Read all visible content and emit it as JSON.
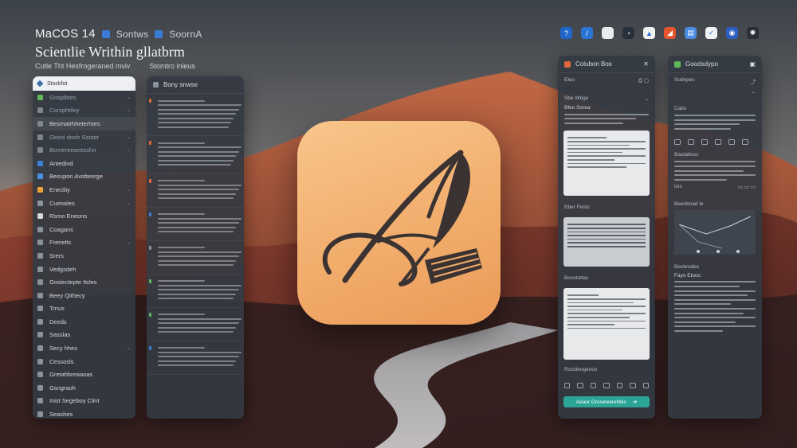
{
  "menubar": {
    "os_label": "MaCOS 14",
    "item_1": "Sontws",
    "item_2": "SoornA"
  },
  "app": {
    "title": "Scientlie Writhin gllatbrm",
    "subtitle_left": "Cutle Tht Hesfrogeraned mviv",
    "subtitle_right": "Stomtro inieus"
  },
  "dock_icons": [
    {
      "name": "safari-icon",
      "color": "#1e66c9",
      "glyph": "?"
    },
    {
      "name": "dictionary-icon",
      "color": "#2a74d6",
      "glyph": "/"
    },
    {
      "name": "notes-icon",
      "color": "#e9ecef",
      "glyph": ""
    },
    {
      "name": "clock-icon",
      "color": "#26303b",
      "glyph": "◔"
    },
    {
      "name": "drive-icon",
      "color": "#f2f2f2",
      "glyph": "▲"
    },
    {
      "name": "office-icon",
      "color": "#e4552d",
      "glyph": "◢"
    },
    {
      "name": "doc-icon",
      "color": "#4a8be0",
      "glyph": "▤"
    },
    {
      "name": "mail-icon",
      "color": "#f0f2f4",
      "glyph": "✓"
    },
    {
      "name": "globe-icon",
      "color": "#2d5fc2",
      "glyph": "◉"
    },
    {
      "name": "settings-icon",
      "color": "#2a2f36",
      "glyph": "✺"
    }
  ],
  "sidebar": {
    "search_label": "Stockfot",
    "items": [
      {
        "label": "Gosplbtes",
        "icon_color": "#5fb85a",
        "chev": "⌄",
        "style": "dim"
      },
      {
        "label": "Corsphtiley",
        "icon_color": "#7e8690",
        "chev": "⌄",
        "style": "dim"
      },
      {
        "label": "Besmatrhheterhtes",
        "icon_color": "#7e8690",
        "chev": "",
        "style": "hl"
      },
      {
        "label": "Gesni dooh Ssotor",
        "icon_color": "#7e8690",
        "chev": "⌄",
        "style": "dim"
      },
      {
        "label": "Bomereeseesshn",
        "icon_color": "#7e8690",
        "chev": "⌄",
        "style": "dim"
      },
      {
        "label": "Antedind",
        "icon_color": "#3e7fd6",
        "chev": "",
        "style": ""
      },
      {
        "label": "Besupon Avstteorge",
        "icon_color": "#4a90e2",
        "chev": "",
        "style": ""
      },
      {
        "label": "Enecliiy",
        "icon_color": "#e8a33b",
        "chev": "⌄",
        "style": ""
      },
      {
        "label": "Cueoales",
        "icon_color": "#8a929c",
        "chev": "⌄",
        "style": ""
      },
      {
        "label": "Rsmo Eneons",
        "icon_color": "#d5d8dc",
        "chev": "",
        "style": ""
      },
      {
        "label": "Coagans",
        "icon_color": "#8a929c",
        "chev": "",
        "style": ""
      },
      {
        "label": "Frenelts",
        "icon_color": "#8a929c",
        "chev": "⌄",
        "style": ""
      },
      {
        "label": "Srers",
        "icon_color": "#8a929c",
        "chev": "",
        "style": ""
      },
      {
        "label": "Vedgsdeh",
        "icon_color": "#8a929c",
        "chev": "",
        "style": ""
      },
      {
        "label": "Goslectepte Itcles",
        "icon_color": "#8a929c",
        "chev": "",
        "style": ""
      },
      {
        "label": "Beey Qithecy",
        "icon_color": "#8a929c",
        "chev": "",
        "style": ""
      },
      {
        "label": "Trnus",
        "icon_color": "#8a929c",
        "chev": "",
        "style": ""
      },
      {
        "label": "Deeds",
        "icon_color": "#8a929c",
        "chev": "",
        "style": ""
      },
      {
        "label": "Sasslas",
        "icon_color": "#8a929c",
        "chev": "",
        "style": ""
      },
      {
        "label": "Secy hhes",
        "icon_color": "#8a929c",
        "chev": "⌄",
        "style": ""
      },
      {
        "label": "Cessosls",
        "icon_color": "#8a929c",
        "chev": "",
        "style": ""
      },
      {
        "label": "Gretahbreaaoas",
        "icon_color": "#8a929c",
        "chev": "",
        "style": ""
      },
      {
        "label": "Gsngraoh",
        "icon_color": "#8a929c",
        "chev": "",
        "style": ""
      },
      {
        "label": "Inist Segeboy Clint",
        "icon_color": "#8a929c",
        "chev": "",
        "style": ""
      },
      {
        "label": "Seashes",
        "icon_color": "#8a929c",
        "chev": "",
        "style": ""
      }
    ]
  },
  "notelist": {
    "header": "Bony snwse",
    "groups": [
      {
        "bar_color": "#e2683a",
        "lines": 7
      },
      {
        "bar_color": "#e2683a",
        "lines": 6
      },
      {
        "bar_color": "#e2683a",
        "lines": 5
      },
      {
        "bar_color": "#3e7fd6",
        "lines": 5
      },
      {
        "bar_color": "#8a929c",
        "lines": 5
      },
      {
        "bar_color": "#5fb85a",
        "lines": 5
      },
      {
        "bar_color": "#5fb85a",
        "lines": 5
      },
      {
        "bar_color": "#3e7fd6",
        "lines": 5
      }
    ]
  },
  "inspector": {
    "header": "Colubon Bos",
    "section_1": "Eleo",
    "section_2": "Sbe Wbge",
    "section_2_sub": "Bfeo Sorea",
    "section_3": "Eber Festo",
    "section_4": "Bosotoltas",
    "section_5": "Rscbleogeoos",
    "cta_label": "Aeaor Grosewarehtes"
  },
  "outline": {
    "header": "Goodsdypo",
    "section_1": "Sodnpes",
    "section_2": "Cabs",
    "section_3": "Baotatless",
    "row_label": "Ixis",
    "section_4": "Beenboad le",
    "section_5": "Becbrodes",
    "section_5_sub": "Fayo Etoos"
  }
}
